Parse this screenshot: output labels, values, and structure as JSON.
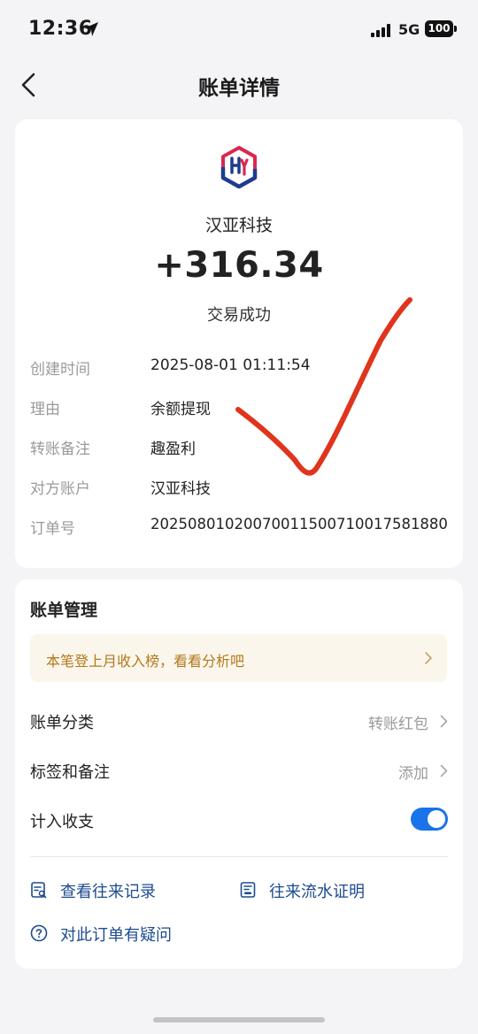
{
  "status_bar": {
    "time": "12:36",
    "network": "5G",
    "battery": "100"
  },
  "header": {
    "title": "账单详情"
  },
  "transaction": {
    "merchant": "汉亚科技",
    "amount": "+316.34",
    "status": "交易成功",
    "rows": [
      {
        "label": "创建时间",
        "value": "2025-08-01 01:11:54"
      },
      {
        "label": "理由",
        "value": "余额提现"
      },
      {
        "label": "转账备注",
        "value": "趣盈利"
      },
      {
        "label": "对方账户",
        "value": "汉亚科技"
      },
      {
        "label": "订单号",
        "value": "2025080102007001150071001758188​0"
      }
    ]
  },
  "manage": {
    "title": "账单管理",
    "promo": "本笔登上月收入榜，看看分析吧",
    "category": {
      "label": "账单分类",
      "value": "转账红包"
    },
    "tags": {
      "label": "标签和备注",
      "value": "添加"
    },
    "count_in": {
      "label": "计入收支",
      "enabled": true
    },
    "links": {
      "history": "查看往来记录",
      "statement": "往来流水证明",
      "question": "对此订单有疑问"
    }
  },
  "colors": {
    "accent": "#1a73e8",
    "link": "#1d4b8f",
    "promo_text": "#b2791c",
    "check_mark": "#e0341c"
  }
}
